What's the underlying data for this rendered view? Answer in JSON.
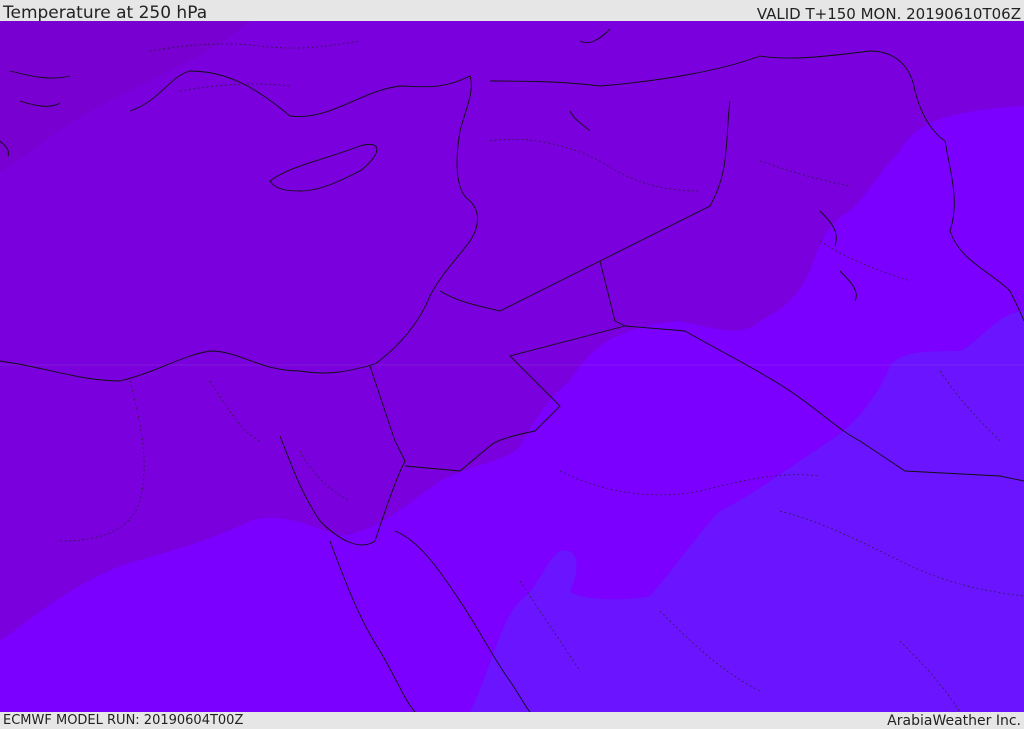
{
  "header": {
    "title": "Temperature at 250 hPa",
    "valid_time": "VALID T+150 MON. 20190610T06Z"
  },
  "footer": {
    "model_run": "ECMWF MODEL RUN: 20190604T00Z",
    "credit": "ArabiaWeather Inc."
  },
  "map": {
    "colors": {
      "coldest_band": "#7700cc",
      "cold_band": "#7a00dd",
      "mid_band": "#7b00ff",
      "warm_band": "#6a14ff",
      "boundary_line": "#111111"
    }
  }
}
